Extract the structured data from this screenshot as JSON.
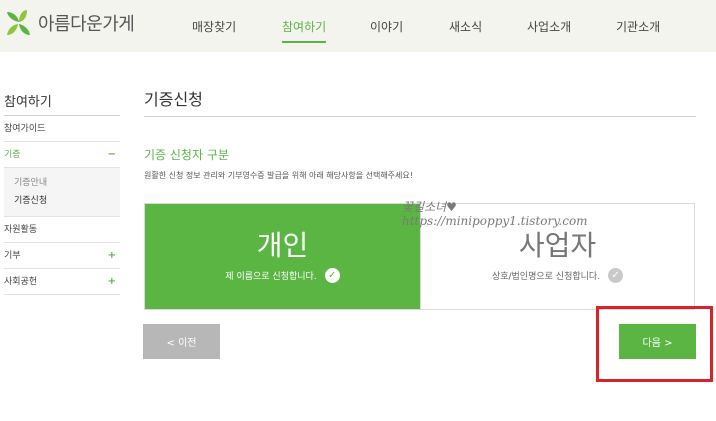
{
  "header": {
    "logo_text": "아름다운가게",
    "nav": [
      {
        "label": "매장찾기",
        "active": false
      },
      {
        "label": "참여하기",
        "active": true
      },
      {
        "label": "이야기",
        "active": false
      },
      {
        "label": "새소식",
        "active": false
      },
      {
        "label": "사업소개",
        "active": false
      },
      {
        "label": "기관소개",
        "active": false
      }
    ]
  },
  "sidebar": {
    "title": "참여하기",
    "items": [
      {
        "label": "참여가이드",
        "mark": ""
      },
      {
        "label": "기증",
        "mark": "−"
      },
      {
        "label": "자원활동",
        "mark": ""
      },
      {
        "label": "기부",
        "mark": "+"
      },
      {
        "label": "사회공헌",
        "mark": "+"
      }
    ],
    "sub_items": [
      "기증안내",
      "기증신청"
    ]
  },
  "main": {
    "page_title": "기증신청",
    "section_title": "기증 신청자 구분",
    "description": "원활한 신청 정보 관리와 기부영수증 발급을 위해 아래 해당사항을 선택해주세요!",
    "choices": [
      {
        "label": "개인",
        "sub": "제 이름으로 신청합니다.",
        "selected": true
      },
      {
        "label": "사업자",
        "sub": "상호/법인명으로 신청합니다.",
        "selected": false
      }
    ],
    "prev_label": "< 이전",
    "next_label": "다음 >"
  },
  "watermark": {
    "line1": "꽃길소녀♥",
    "line2": "https://minipoppy1.tistory.com"
  },
  "colors": {
    "brand_green": "#5bb543",
    "highlight_red": "#d8232a"
  },
  "icons": [
    "leaf-logo-icon",
    "check-circle-icon"
  ]
}
